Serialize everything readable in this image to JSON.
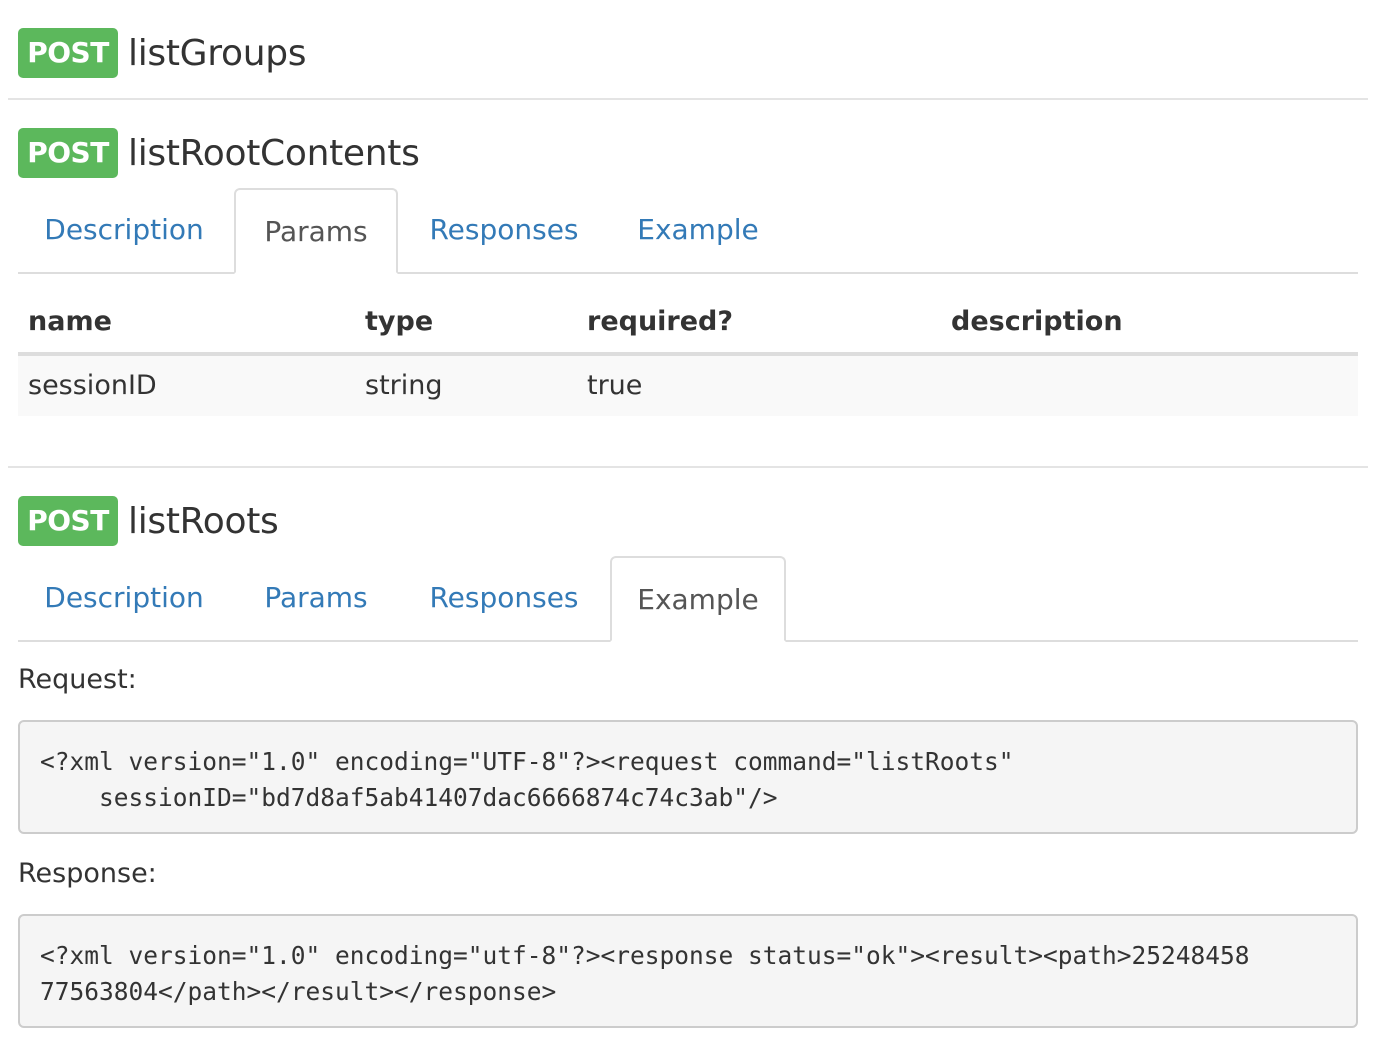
{
  "endpoints": [
    {
      "method": "POST",
      "name": "listGroups"
    },
    {
      "method": "POST",
      "name": "listRootContents",
      "tabs": [
        "Description",
        "Params",
        "Responses",
        "Example"
      ],
      "active_tab": "Params",
      "params_table": {
        "headers": [
          "name",
          "type",
          "required?",
          "description"
        ],
        "rows": [
          [
            "sessionID",
            "string",
            "true",
            ""
          ]
        ]
      }
    },
    {
      "method": "POST",
      "name": "listRoots",
      "tabs": [
        "Description",
        "Params",
        "Responses",
        "Example"
      ],
      "active_tab": "Example",
      "example": {
        "request_label": "Request:",
        "request_code": "<?xml version=\"1.0\" encoding=\"UTF-8\"?><request command=\"listRoots\"\n    sessionID=\"bd7d8af5ab41407dac6666874c74c3ab\"/>",
        "response_label": "Response:",
        "response_code": "<?xml version=\"1.0\" encoding=\"utf-8\"?><response status=\"ok\"><result><path>25248458\n77563804</path></result></response>"
      }
    }
  ],
  "colors": {
    "post_badge": "#5cb85c",
    "tab_link": "#337ab7",
    "tab_active_text": "#555555",
    "rule": "#e4e4e4"
  }
}
